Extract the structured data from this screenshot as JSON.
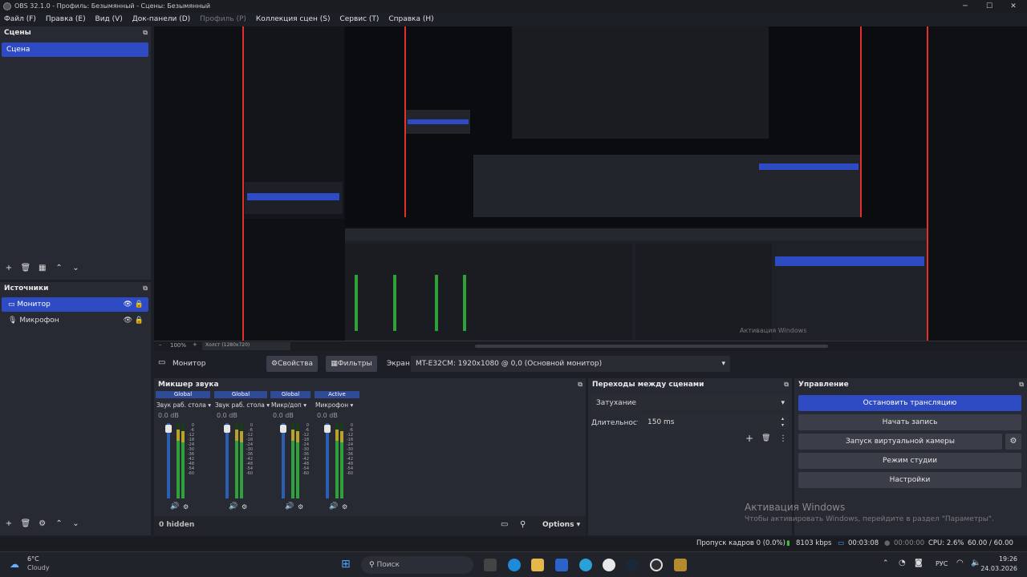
{
  "window": {
    "title": "OBS 32.1.0 - Профиль: Безымянный - Сцены: Безымянный"
  },
  "menu": [
    "Файл (F)",
    "Правка (E)",
    "Вид (V)",
    "Док-панели (D)",
    "Профиль (P)",
    "Коллекция сцен (S)",
    "Сервис (T)",
    "Справка (H)"
  ],
  "scenes": {
    "title": "Сцены",
    "items": [
      "Сцена"
    ]
  },
  "sources": {
    "title": "Источники",
    "items": [
      "Монитор",
      "Микрофон"
    ]
  },
  "preview": {
    "zoom": "100%",
    "canvas": "Холст (1280x720)"
  },
  "sourcebar": {
    "selected": "Монитор",
    "properties": "Свойства",
    "filters": "Фильтры",
    "screen_label": "Экран",
    "screen_value": "MT-E32CM: 1920x1080 @ 0,0 (Основной монитор)"
  },
  "mixer": {
    "title": "Микшер звука",
    "channels": [
      {
        "badge": "Global",
        "name": "Звук раб. стола",
        "db": "0.0 dB"
      },
      {
        "badge": "Global",
        "name": "Звук раб. стола",
        "db": "0.0 dB"
      },
      {
        "badge": "Global",
        "name": "Микр/доп",
        "db": "0.0 dB"
      },
      {
        "badge": "Active",
        "name": "Микрофон",
        "db": "0.0 dB"
      }
    ],
    "ticks": [
      "0",
      "-6",
      "-12",
      "-18",
      "-24",
      "-30",
      "-36",
      "-42",
      "-48",
      "-54",
      "-60"
    ],
    "hidden": "0 hidden",
    "options": "Options"
  },
  "transitions": {
    "title": "Переходы между сценами",
    "type": "Затухание",
    "duration_label": "Длительность",
    "duration": "150 ms"
  },
  "controls": {
    "title": "Управление",
    "stop_stream": "Остановить трансляцию",
    "start_record": "Начать запись",
    "virtual_cam": "Запуск виртуальной камеры",
    "studio_mode": "Режим студии",
    "settings": "Настройки"
  },
  "watermark": {
    "line1": "Активация Windows",
    "line2": "Чтобы активировать Windows, перейдите в раздел \"Параметры\"."
  },
  "status": {
    "dropped": "Пропуск кадров 0 (0.0%)",
    "bitrate": "8103 kbps",
    "stream_time": "00:03:08",
    "record_time": "00:00:00",
    "cpu": "CPU: 2.6%",
    "fps": "60.00 / 60.00 FPS"
  },
  "taskbar": {
    "temp": "6°C",
    "weather": "Cloudy",
    "search": "Поиск",
    "lang": "РУС",
    "time": "19:26",
    "date": "24.03.2026"
  },
  "colors": {
    "accent": "#2f4bc4",
    "live": "#e2312d"
  }
}
